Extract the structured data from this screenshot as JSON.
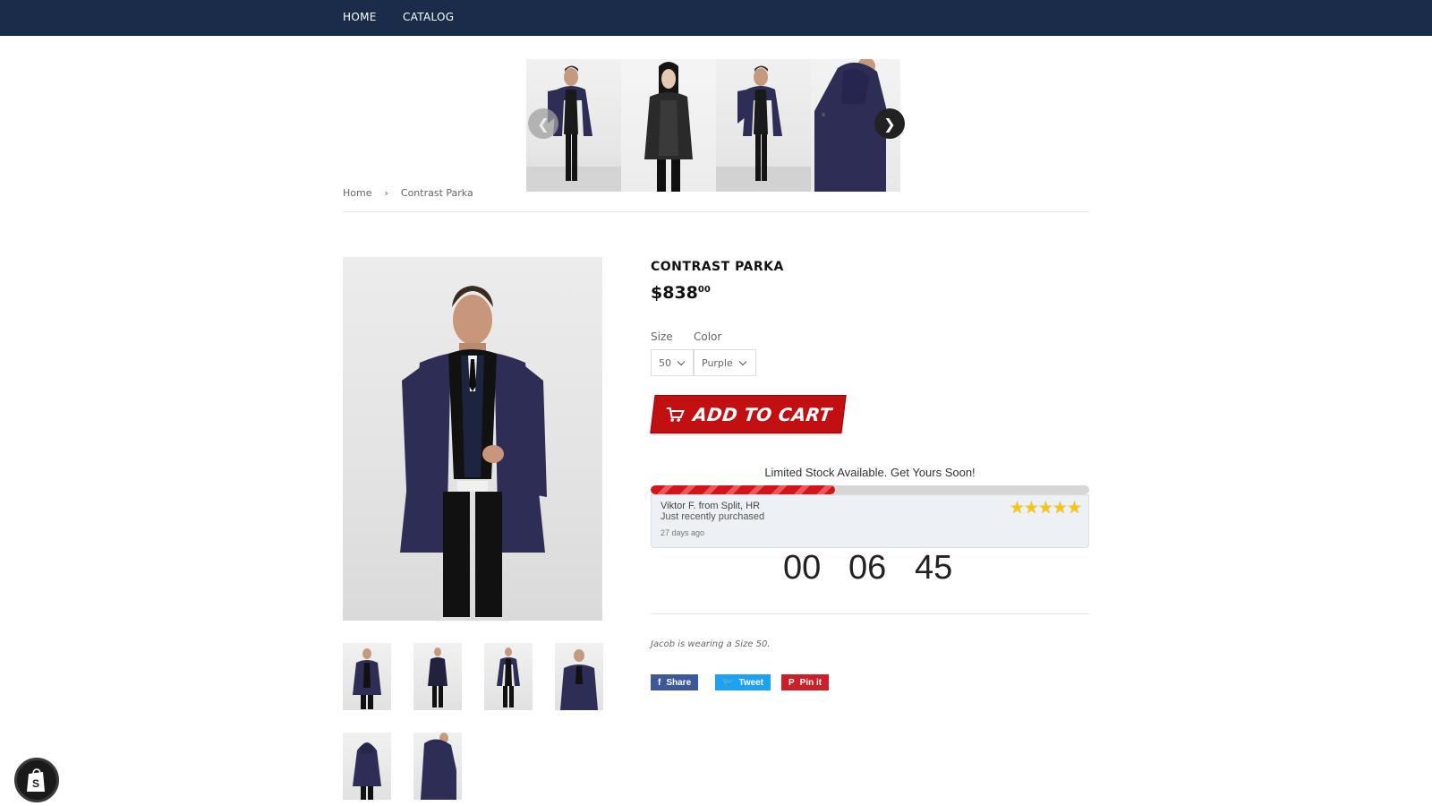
{
  "nav": {
    "items": [
      {
        "label": "HOME"
      },
      {
        "label": "CATALOG"
      }
    ]
  },
  "carousel": {
    "prev_icon": "chevron-left-icon",
    "next_icon": "chevron-right-icon",
    "slides": [
      {
        "subject": "man in open dark parka"
      },
      {
        "subject": "woman in black jacket"
      },
      {
        "subject": "man in open dark parka"
      },
      {
        "subject": "hooded parka side view"
      }
    ]
  },
  "breadcrumb": {
    "home": "Home",
    "separator": "›",
    "current": "Contrast Parka"
  },
  "product": {
    "title": "CONTRAST PARKA",
    "price_main": "$838",
    "price_cents": "00",
    "size_label": "Size",
    "color_label": "Color",
    "size_value": "50",
    "color_value": "Purple",
    "add_to_cart": "ADD TO CART",
    "note": "Jacob is wearing a Size 50."
  },
  "stock": {
    "message": "Limited Stock Available. Get Yours Soon!",
    "progress_percent": 42
  },
  "recent_purchase": {
    "name": "Viktor F. from Split, HR",
    "action": "Just recently purchased",
    "ago": "27 days ago",
    "stars": "★★★★★"
  },
  "timer": {
    "hours": "00",
    "minutes": "06",
    "seconds": "45"
  },
  "share": {
    "facebook": "Share",
    "twitter": "Tweet",
    "pinterest": "Pin it"
  },
  "colors": {
    "nav_bg": "#1b2c4a",
    "cart_red": "#c20f12",
    "facebook": "#3b5998",
    "twitter": "#1da1f2",
    "pinterest": "#cb2027",
    "parka_navy": "#2e2d55"
  }
}
